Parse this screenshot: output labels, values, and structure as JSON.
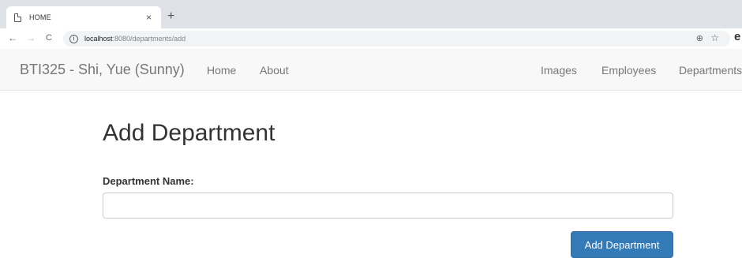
{
  "browser": {
    "tab_title": "HOME",
    "tab_close": "×",
    "new_tab": "+",
    "back": "←",
    "forward": "→",
    "reload": "C",
    "url_host": "localhost",
    "url_path": ":8080/departments/add",
    "info_icon": "i",
    "zoom_icon": "⊕",
    "star_icon": "☆",
    "profile_icon": "e"
  },
  "navbar": {
    "brand": "BTI325 - Shi, Yue (Sunny)",
    "left_links": [
      "Home",
      "About"
    ],
    "right_links": [
      "Images",
      "Employees",
      "Departments"
    ]
  },
  "main": {
    "title": "Add Department",
    "field_label": "Department Name:",
    "field_value": "",
    "field_placeholder": "",
    "submit_label": "Add Department"
  },
  "colors": {
    "primary_button": "#337ab7",
    "navbar_bg": "#f8f8f8"
  }
}
